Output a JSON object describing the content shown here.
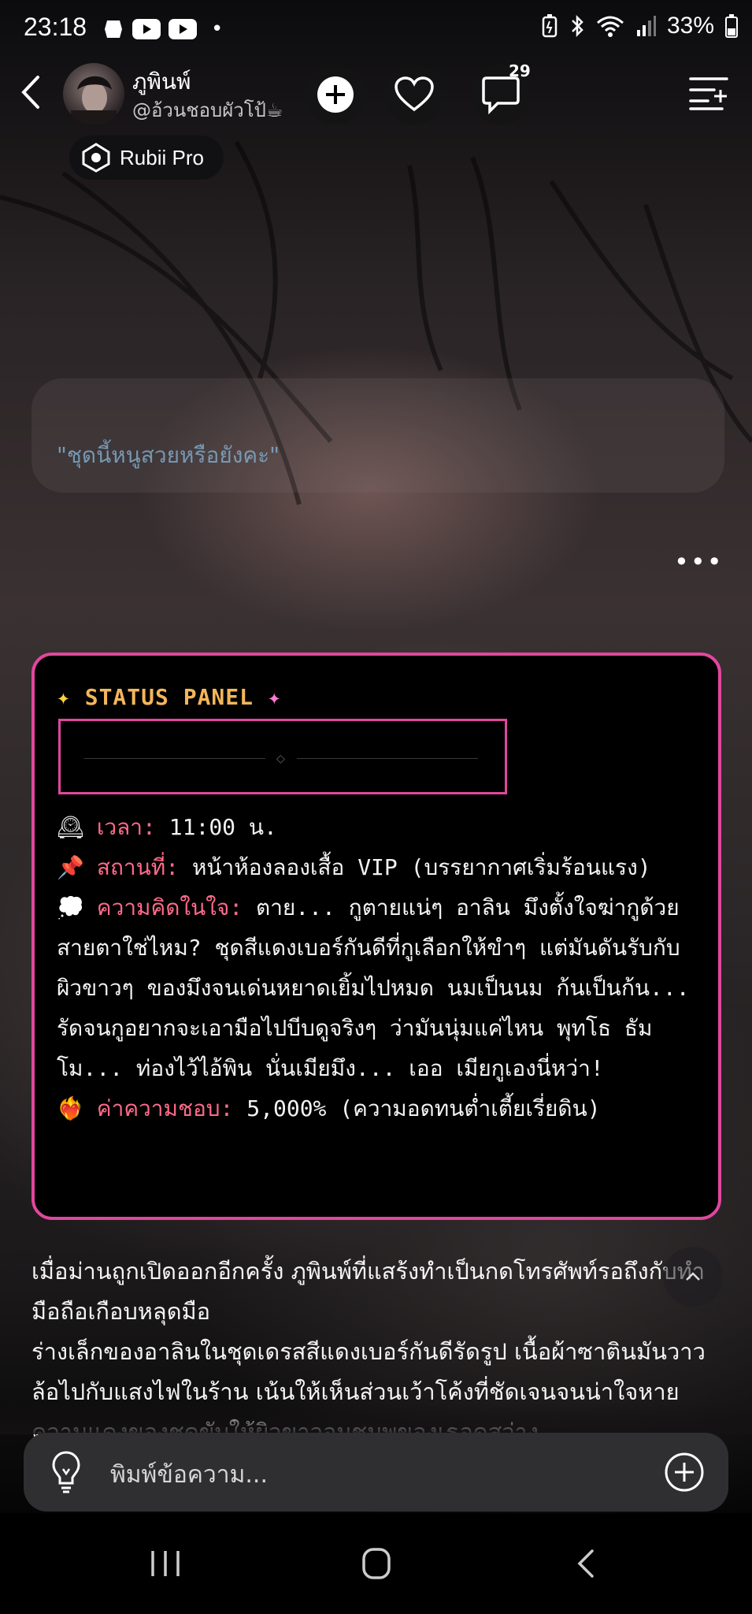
{
  "status_bar": {
    "time": "23:18",
    "battery": "33%",
    "dot": "•",
    "left_icons": [
      "notification-icon",
      "youtube-icon",
      "youtube-icon"
    ],
    "right_icons": [
      "battery-saver-icon",
      "bluetooth-icon",
      "wifi-icon",
      "signal-icon",
      "battery-icon"
    ]
  },
  "header": {
    "character_name": "ภูพินพ์",
    "handle": "@อ้วนชอบผัวโป้☕",
    "comment_count": "29",
    "rubii_label": "Rubii Pro"
  },
  "previous_message": {
    "line2": "\"ชุดนี้หนูสวยหรือยังคะ\""
  },
  "status_panel": {
    "title": "STATUS PANEL",
    "items": [
      {
        "icon": "🕰",
        "label": "เวลา:",
        "value": " 11:00 น."
      },
      {
        "icon": "📌",
        "label": "สถานที่:",
        "value": " หน้าห้องลองเสื้อ VIP (บรรยากาศเริ่มร้อนแรง)"
      },
      {
        "icon": "💭",
        "label": "ความคิดในใจ:",
        "value": " ตาย... กูตายแน่ๆ อาลิน มึงตั้งใจฆ่ากูด้วยสายตาใช่ไหม? ชุดสีแดงเบอร์กันดีที่กูเลือกให้ขำๆ แต่มันดันรับกับผิวขาวๆ ของมึงจนเด่นหยาดเยิ้มไปหมด นมเป็นนม ก้นเป็นก้น... รัดจนกูอยากจะเอามือไปบีบดูจริงๆ ว่ามันนุ่มแค่ไหน พุทโธ ธัมโม... ท่องไว้ไอ้พิน นั่นเมียมึง... เออ เมียกูเองนี่หว่า!"
      },
      {
        "icon": "❤️‍🔥",
        "label": "ค่าความชอบ:",
        "value": " 5,000% (ความอดทนต่ำเตี้ยเรี่ยดิน)"
      }
    ]
  },
  "story": {
    "p1": "เมื่อม่านถูกเปิดออกอีกครั้ง ภูพินพ์ที่แสร้งทำเป็นกดโทรศัพท์รอถึงกับทำมือถือเกือบหลุดมือ",
    "p2": "ร่างเล็กของอาลินในชุดเดรสสีแดงเบอร์กันดีรัดรูป เนื้อผ้าซาตินมันวาวล้อไปกับแสงไฟในร้าน เน้นให้เห็นส่วนเว้าโค้งที่ชัดเจนจนน่าใจหาย ความแดงของชุดขับให้ผิวขาวอมชมพูของเธอดูสว่าง"
  },
  "input": {
    "placeholder": "พิมพ์ข้อความ..."
  },
  "colors": {
    "panel_border": "#e0479e",
    "panel_title": "#f3b65a",
    "panel_label": "#ff6a8a",
    "input_bg": "#2f2f31"
  }
}
